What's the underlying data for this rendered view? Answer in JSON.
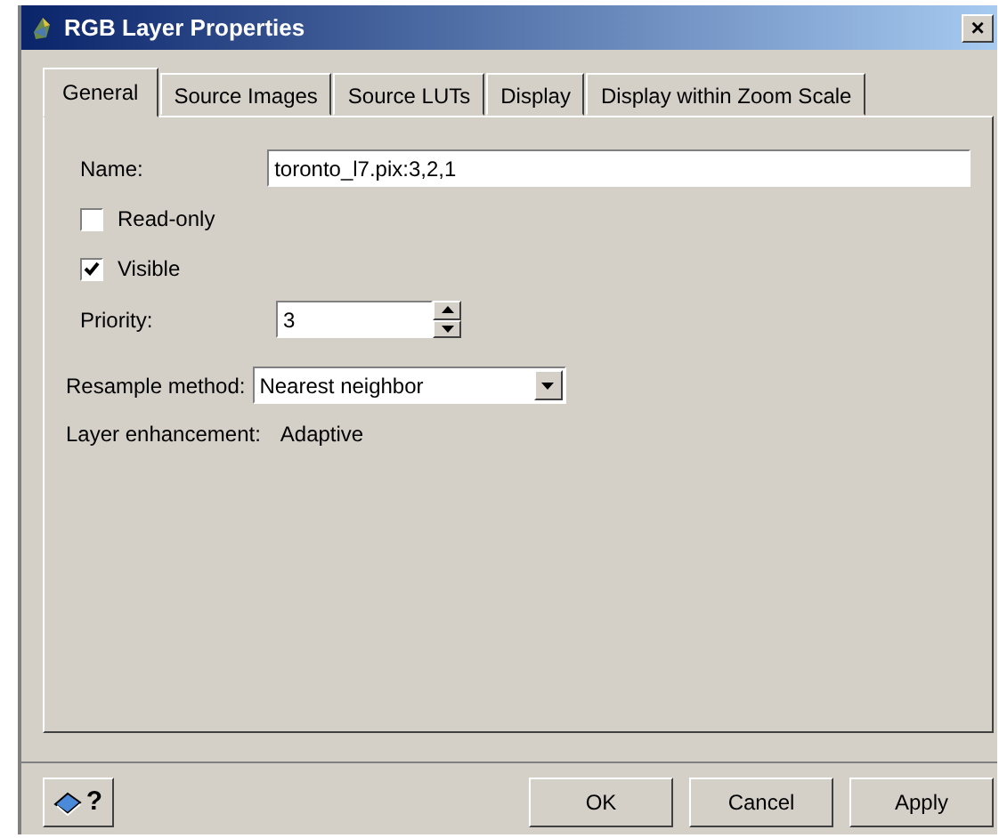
{
  "window": {
    "title": "RGB Layer Properties",
    "close": "×"
  },
  "tabs": [
    {
      "label": "General",
      "selected": true
    },
    {
      "label": "Source Images",
      "selected": false
    },
    {
      "label": "Source LUTs",
      "selected": false
    },
    {
      "label": "Display",
      "selected": false
    },
    {
      "label": "Display within Zoom Scale",
      "selected": false
    }
  ],
  "name": {
    "label": "Name:",
    "value": "toronto_l7.pix:3,2,1"
  },
  "checkboxes": [
    {
      "label": "Read-only",
      "checked": false
    },
    {
      "label": "Visible",
      "checked": true
    }
  ],
  "priority": {
    "label": "Priority:",
    "value": "3"
  },
  "resample": {
    "label": "Resample method:",
    "value": "Nearest neighbor"
  },
  "enhancement": {
    "label": "Layer enhancement:",
    "value": "Adaptive"
  },
  "help_button": {
    "label": "?"
  },
  "buttons": [
    "OK",
    "Cancel",
    "Apply"
  ]
}
